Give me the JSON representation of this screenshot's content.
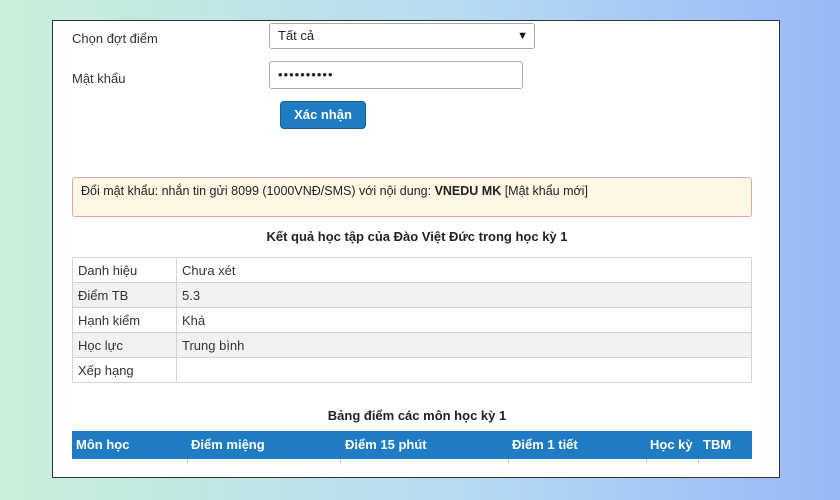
{
  "form": {
    "period_label": "Chọn đợt điểm",
    "period_value": "Tất cả",
    "password_label": "Mật khẩu",
    "password_value": "••••••••••",
    "confirm_label": "Xác nhận"
  },
  "notice": {
    "text": "Đổi mật khẩu: nhắn tin gửi 8099 (1000VNĐ/SMS) với nội dung: ",
    "code": "VNEDU MK",
    "suffix": " [Mật khẩu mới]"
  },
  "result": {
    "title": "Kết quả học tập của Đào Việt Đức trong học kỳ 1",
    "rows": [
      {
        "key": "Danh hiệu",
        "value": "Chưa xét"
      },
      {
        "key": "Điểm TB",
        "value": "5.3"
      },
      {
        "key": "Hạnh kiểm",
        "value": "Khá"
      },
      {
        "key": "Học lực",
        "value": "Trung bình"
      },
      {
        "key": "Xếp hạng",
        "value": ""
      }
    ]
  },
  "grades": {
    "title": "Bảng điểm các môn học kỳ 1",
    "columns": [
      "Môn học",
      "Điểm miệng",
      "Điểm 15 phút",
      "Điểm 1 tiết",
      "Học kỳ",
      "TBM"
    ]
  },
  "colors": {
    "primary": "#1f7bc2",
    "notice_bg": "#fcf8e3",
    "notice_border": "#e0a8a8"
  }
}
